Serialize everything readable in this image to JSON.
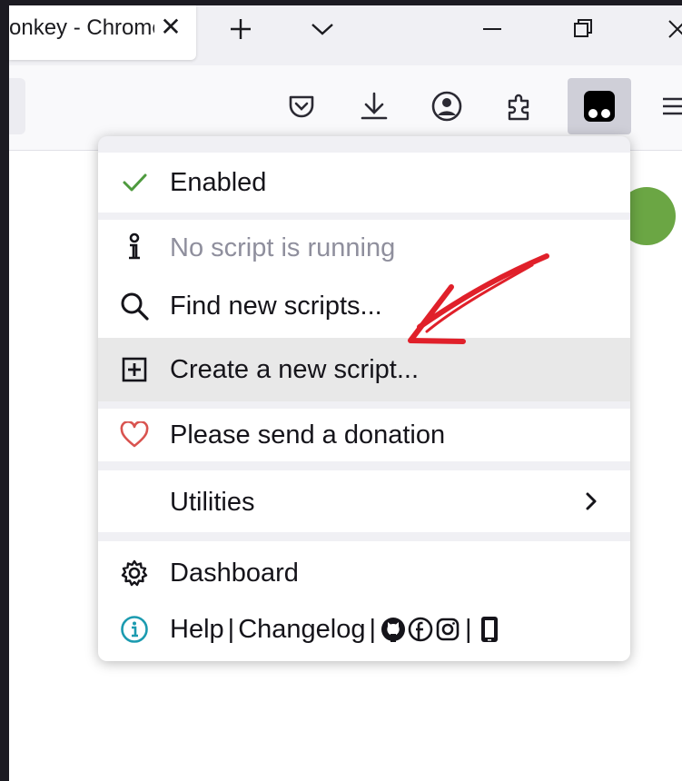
{
  "tab": {
    "title": "onkey - Chrome",
    "close_glyph": "✕"
  },
  "icons": {
    "new_tab": "plus-icon",
    "tab_list": "chevron-down-icon",
    "minimize": "minimize-icon",
    "restore": "restore-icon",
    "close": "close-icon",
    "pocket": "pocket-icon",
    "downloads": "download-icon",
    "account": "account-icon",
    "extensions": "puzzle-icon",
    "tampermonkey": "tampermonkey-icon",
    "app_menu": "hamburger-menu-icon"
  },
  "menu": {
    "enabled": "Enabled",
    "no_script": "No script is running",
    "find_scripts": "Find new scripts...",
    "create_script": "Create a new script...",
    "donate": "Please send a donation",
    "utilities": "Utilities",
    "dashboard": "Dashboard",
    "help": "Help",
    "changelog": "Changelog",
    "separator": "|"
  },
  "colors": {
    "check_green": "#4e9a3e",
    "heart_red": "#d9534f",
    "info_teal": "#1c9bb0",
    "arrow_red": "#e0202a",
    "page_green": "#6ba644"
  }
}
